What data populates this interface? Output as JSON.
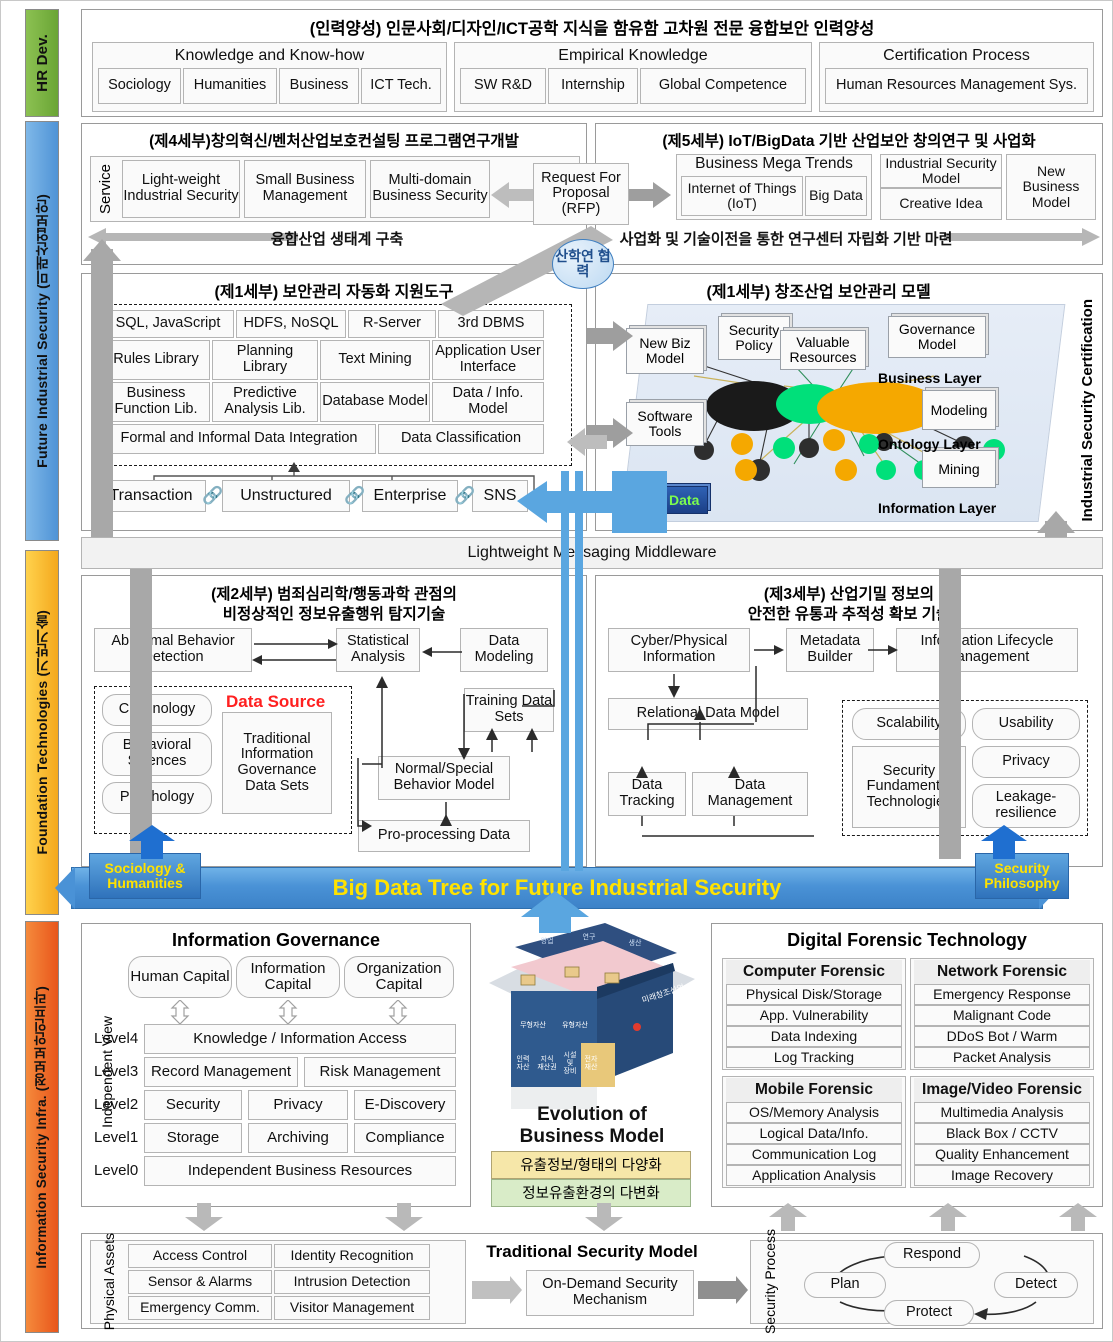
{
  "rails": [
    {
      "id": "hr",
      "label": "HR Dev."
    },
    {
      "id": "fis",
      "label": "Future Industrial Security (미래산업보안)"
    },
    {
      "id": "ft",
      "label": "Foundation Technologies (기반기술)"
    },
    {
      "id": "isi",
      "label": "Information Security Infra. (정보보안인프라)"
    }
  ],
  "hr": {
    "title": "(인력양성) 인문사회/디자인/ICT공학 지식을 함유함 고차원 전문 융합보안 인력양성",
    "groups": [
      {
        "header": "Knowledge and Know-how",
        "items": [
          "Sociology",
          "Humanities",
          "Business",
          "ICT Tech."
        ]
      },
      {
        "header": "Empirical Knowledge",
        "items": [
          "SW R&D",
          "Internship",
          "Global Competence"
        ]
      },
      {
        "header": "Certification Process",
        "items": [
          "Human Resources Management Sys."
        ]
      }
    ]
  },
  "part4": {
    "title": "(제4세부)창의혁신/벤처산업보호컨설팅 프로그램연구개발",
    "side_label": "Service",
    "items": [
      "Light-weight Industrial Security",
      "Small Business Management",
      "Multi-domain Business Security"
    ],
    "arrow_text": "융합산업 생태계 구축",
    "rfp": "Request For Proposal (RFP)"
  },
  "part5": {
    "title": "(제5세부) IoT/BigData 기반 산업보안 창의연구 및 사업화",
    "mega_header": "Business Mega Trends",
    "mega_items": [
      "Internet of Things (IoT)",
      "Big Data"
    ],
    "right_items": [
      "Industrial Security Model",
      "Creative Idea"
    ],
    "new_model": "New Business Model",
    "arrow_text": "사업화 및 기술이전을 통한 연구센터 자립화 기반 마련"
  },
  "collab_circle": "산학연 협력",
  "part1_tools": {
    "title": "(제1세부) 보안관리 자동화 지원도구",
    "row1": [
      "SQL, JavaScript",
      "HDFS, NoSQL",
      "R-Server",
      "3rd DBMS"
    ],
    "row2": [
      "Rules Library",
      "Planning Library",
      "Text Mining",
      "Application User Interface"
    ],
    "row3": [
      "Business Function Lib.",
      "Predictive Analysis Lib.",
      "Database Model",
      "Data / Info. Model"
    ],
    "row4": [
      "Formal and Informal Data Integration",
      "Data Classification"
    ],
    "sources": [
      "Transaction",
      "Unstructured",
      "Enterprise",
      "SNS"
    ]
  },
  "part1_model": {
    "title": "(제1세부) 창조산업 보안관리 모델",
    "cubes": [
      "New Biz Model",
      "Security Policy",
      "Valuable Resources",
      "Governance Model",
      "Software Tools",
      "Modeling",
      "Mining"
    ],
    "bigdata": "Big Data",
    "layers": [
      "Business Layer",
      "Ontology Layer",
      "Information Layer"
    ],
    "cert_label": "Industrial Security Certification"
  },
  "middleware": "Lightweight Messaging Middleware",
  "part2": {
    "title_line1": "(제2세부) 범죄심리학/행동과학 관점의",
    "title_line2": "비정상적인 정보유출행위 탐지기술",
    "top_boxes": [
      "Abnormal Behavior Detection",
      "Statistical Analysis",
      "Data Modeling"
    ],
    "data_source_label": "Data Source",
    "disciplines": [
      "Criminology",
      "Behavioral Sciences",
      "Psychology"
    ],
    "governance_box": "Traditional Information Governance Data Sets",
    "right_boxes": [
      "Training Data Sets",
      "Normal/Special Behavior Model",
      "Pro-processing Data"
    ]
  },
  "part3": {
    "title_line1": "(제3세부) 산업기밀 정보의",
    "title_line2": "안전한 유통과 추적성 확보 기술",
    "top_boxes": [
      "Cyber/Physical Information",
      "Metadata Builder",
      "Information Lifecycle Management"
    ],
    "mid_box": "Relational Data Model",
    "bottom_boxes": [
      "Data Tracking",
      "Data Management"
    ],
    "pill_boxes": [
      "Scalability",
      "Usability",
      "Privacy",
      "Leakage-resilience"
    ],
    "fundamental_box": "Security Fundamental Technologies"
  },
  "tree_band": {
    "label": "Big Data Tree for Future Industrial Security",
    "left_badge": "Sociology & Humanities",
    "right_badge": "Security Philosophy"
  },
  "info_gov": {
    "title": "Information Governance",
    "side_label": "Independent View",
    "capitals": [
      "Human Capital",
      "Information Capital",
      "Organization Capital"
    ],
    "levels": [
      {
        "level": "Level4",
        "items": [
          "Knowledge / Information Access"
        ]
      },
      {
        "level": "Level3",
        "items": [
          "Record Management",
          "Risk Management"
        ]
      },
      {
        "level": "Level2",
        "items": [
          "Security",
          "Privacy",
          "E-Discovery"
        ]
      },
      {
        "level": "Level1",
        "items": [
          "Storage",
          "Archiving",
          "Compliance"
        ]
      },
      {
        "level": "Level0",
        "items": [
          "Independent Business Resources"
        ]
      }
    ]
  },
  "evolution": {
    "title_line1": "Evolution of",
    "title_line2": "Business Model",
    "band1": "유출정보/형태의 다양화",
    "band2": "정보유출환경의 다변화",
    "cube_labels": [
      "무형자산",
      "유형자산",
      "인력자산",
      "지식재산권",
      "시설 및 장비자산",
      "전자적 재산"
    ]
  },
  "forensic": {
    "title": "Digital Forensic Technology",
    "quadrants": [
      {
        "header": "Computer Forensic",
        "items": [
          "Physical Disk/Storage",
          "App. Vulnerability",
          "Data Indexing",
          "Log Tracking"
        ]
      },
      {
        "header": "Network Forensic",
        "items": [
          "Emergency Response",
          "Malignant Code",
          "DDoS Bot / Warm",
          "Packet Analysis"
        ]
      },
      {
        "header": "Mobile Forensic",
        "items": [
          "OS/Memory Analysis",
          "Logical Data/Info.",
          "Communication Log",
          "Application Analysis"
        ]
      },
      {
        "header": "Image/Video Forensic",
        "items": [
          "Multimedia Analysis",
          "Black Box / CCTV",
          "Quality Enhancement",
          "Image Recovery"
        ]
      }
    ]
  },
  "traditional": {
    "title": "Traditional Security Model",
    "assets_label": "Physical Assets",
    "assets": [
      [
        "Access Control",
        "Identity Recognition"
      ],
      [
        "Sensor & Alarms",
        "Intrusion Detection"
      ],
      [
        "Emergency Comm.",
        "Visitor Management"
      ]
    ],
    "mechanism": "On-Demand Security Mechanism",
    "process_label": "Security Process",
    "process": [
      "Plan",
      "Protect",
      "Detect",
      "Respond"
    ]
  },
  "colors": {
    "hr": "#8cc152",
    "future": "#4f93d6",
    "foundation": "#f4a81d",
    "infra": "#e8561b",
    "band": "#4a92d6",
    "band_text": "#ffe200",
    "data_source": "#ff2020"
  }
}
